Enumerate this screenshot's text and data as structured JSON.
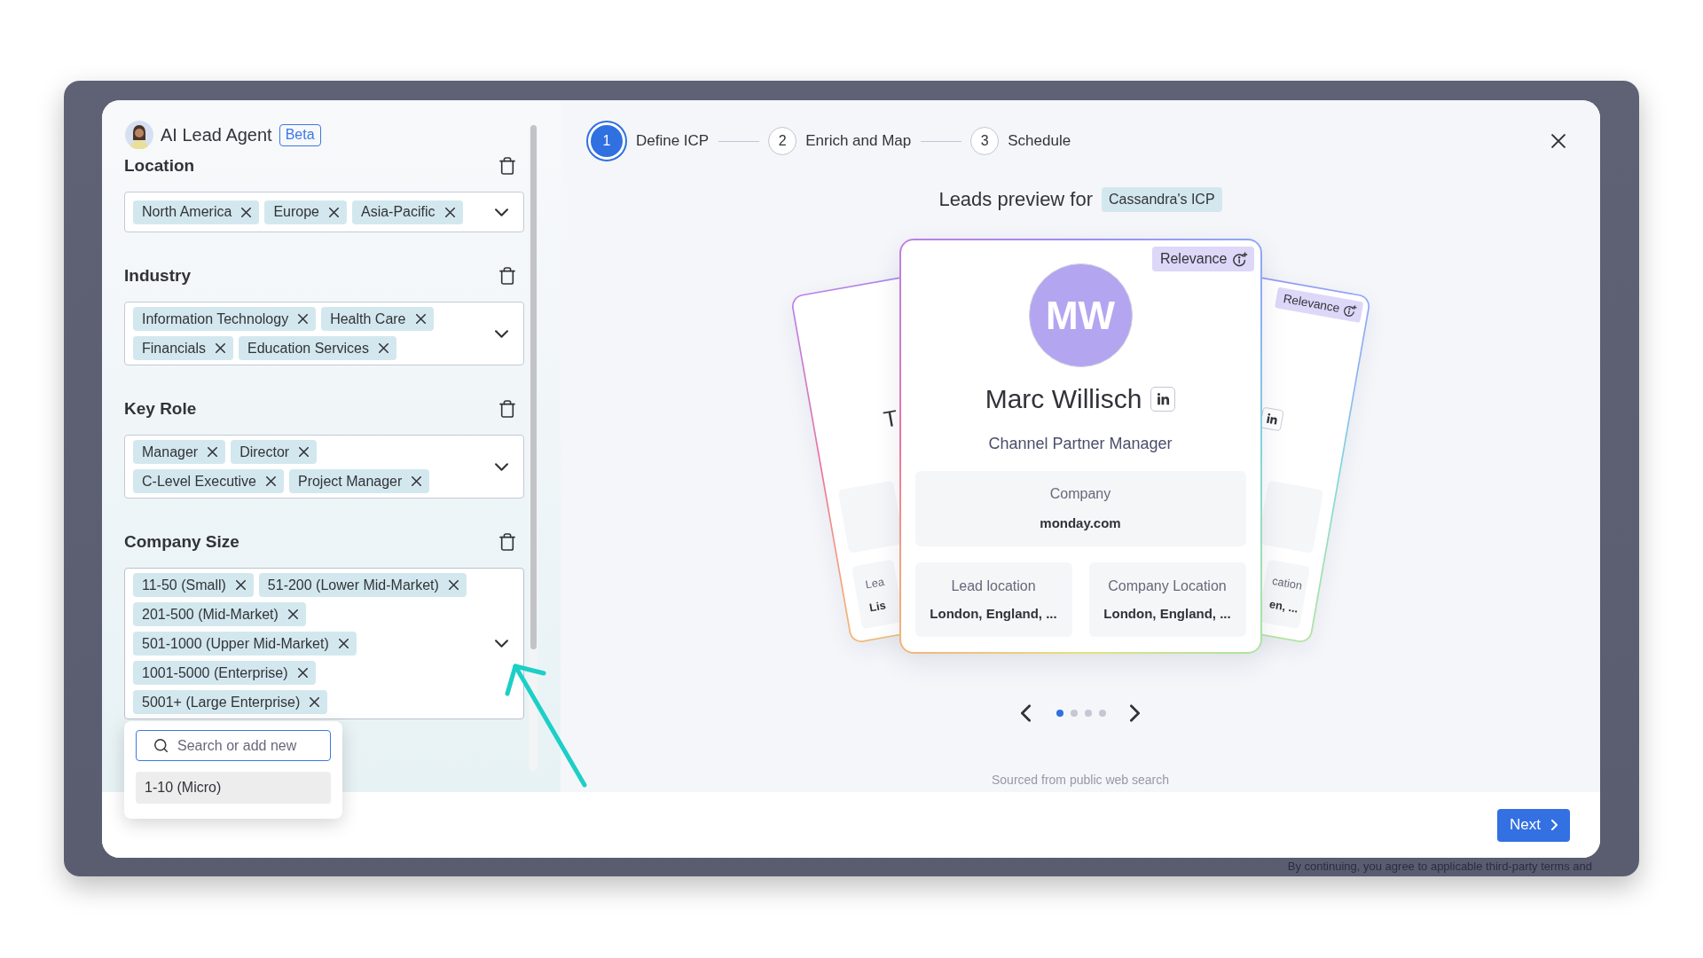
{
  "app": {
    "notice": "By continuing, you agree to applicable third-party terms and"
  },
  "agent": {
    "name": "AI Lead Agent",
    "badge": "Beta"
  },
  "filters": [
    {
      "label": "Location",
      "expanded": false,
      "rows": [
        [
          "North America",
          "Europe",
          "Asia-Pacific"
        ]
      ]
    },
    {
      "label": "Industry",
      "expanded": false,
      "rows": [
        [
          "Information Technology",
          "Health Care"
        ],
        [
          "Financials",
          "Education Services"
        ]
      ]
    },
    {
      "label": "Key Role",
      "expanded": false,
      "rows": [
        [
          "Manager",
          "Director"
        ],
        [
          "C-Level Executive",
          "Project Manager"
        ]
      ]
    },
    {
      "label": "Company Size",
      "expanded": true,
      "rows": [
        [
          "11-50 (Small)",
          "51-200 (Lower Mid-Market)"
        ],
        [
          "201-500 (Mid-Market)"
        ],
        [
          "501-1000 (Upper Mid-Market)"
        ],
        [
          "1001-5000 (Enterprise)"
        ],
        [
          "5001+ (Large Enterprise)"
        ]
      ],
      "menu": {
        "placeholder": "Search or add new",
        "options": [
          {
            "label": "1-10 (Micro)",
            "highlighted": true
          }
        ]
      }
    }
  ],
  "steps": [
    {
      "number": "1",
      "label": "Define ICP",
      "selected": true
    },
    {
      "number": "2",
      "label": "Enrich and Map",
      "selected": false
    },
    {
      "number": "3",
      "label": "Schedule",
      "selected": false
    }
  ],
  "preview": {
    "title": "Leads preview for",
    "icp": "Cassandra's ICP"
  },
  "lead_card": {
    "relevance": "Relevance",
    "initials": "MW",
    "name": "Marc Willisch",
    "title": "Channel Partner Manager",
    "company_label": "Company",
    "company": "monday.com",
    "lead_location_label": "Lead location",
    "lead_location": "London, England, ...",
    "company_location_label": "Company Location",
    "company_location": "London, England, ..."
  },
  "left_card": {
    "name": "T",
    "lead_location_label": "Lea",
    "lead_location": "Lis"
  },
  "right_card": {
    "relevance": "Relevance",
    "company_location_label": "cation",
    "company_location": "en, ..."
  },
  "carousel": {
    "dots": [
      {
        "selected": true
      },
      {
        "selected": false
      },
      {
        "selected": false
      },
      {
        "selected": false
      }
    ]
  },
  "source_note": "Sourced from public web search",
  "footer": {
    "next": "Next"
  }
}
